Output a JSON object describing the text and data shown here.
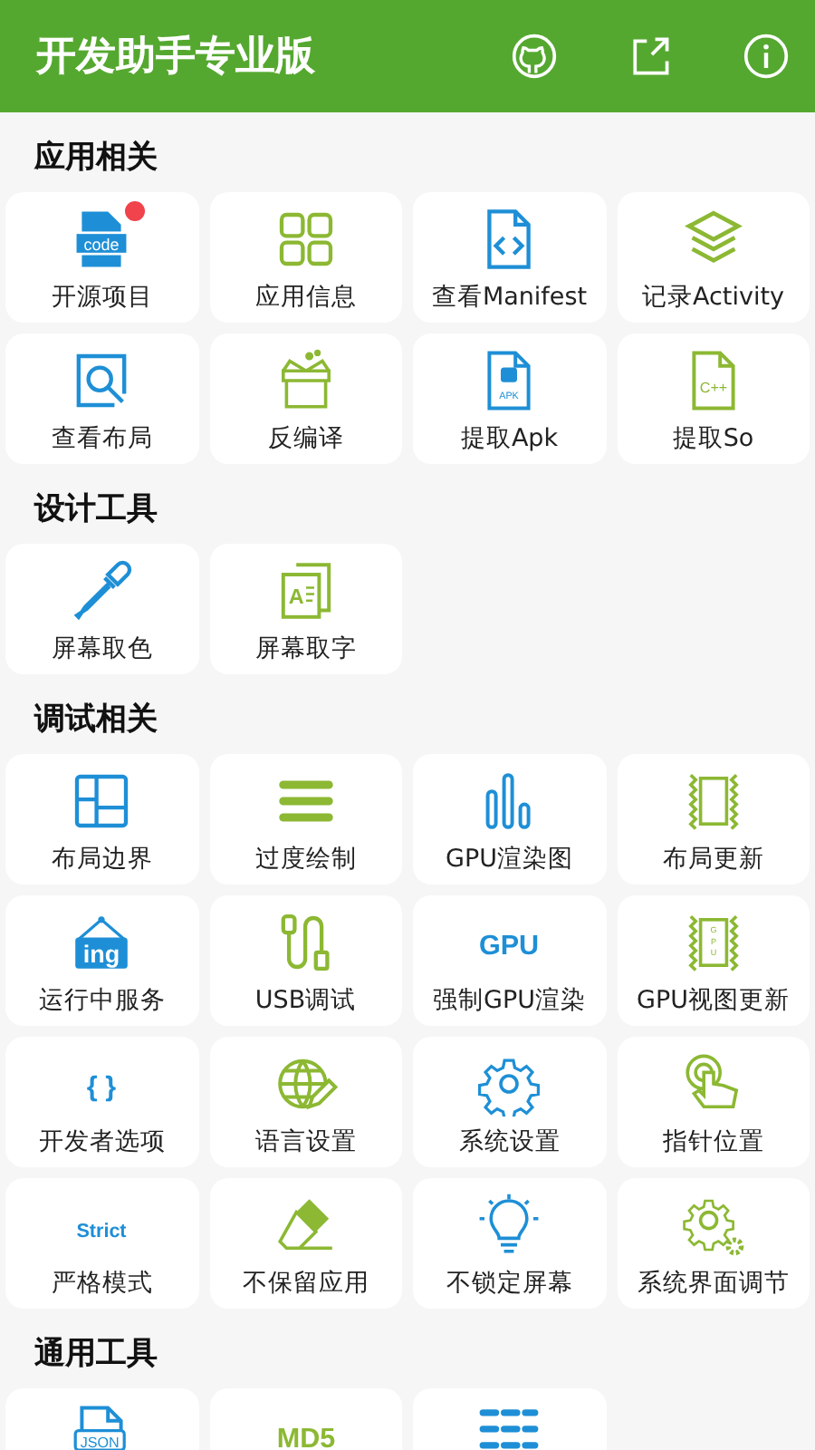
{
  "app_bar": {
    "title": "开发助手专业版",
    "actions": [
      {
        "kind": "github"
      },
      {
        "kind": "share"
      },
      {
        "kind": "info"
      }
    ]
  },
  "sections": [
    {
      "title": "应用相关",
      "items": [
        {
          "label": "开源项目",
          "kind": "code-file",
          "icon_text": "code",
          "color": "#1e8fd6",
          "badge": true
        },
        {
          "label": "应用信息",
          "kind": "grid",
          "color": "#8cb833",
          "badge": false
        },
        {
          "label": "查看Manifest",
          "kind": "manifest",
          "color": "#1e8fd6",
          "badge": false
        },
        {
          "label": "记录Activity",
          "kind": "layers",
          "color": "#8cb833",
          "badge": false
        },
        {
          "label": "查看布局",
          "kind": "search-frame",
          "color": "#1e8fd6",
          "badge": false
        },
        {
          "label": "反编译",
          "kind": "box",
          "color": "#8cb833",
          "badge": false
        },
        {
          "label": "提取Apk",
          "kind": "apk-file",
          "icon_text": "APK",
          "color": "#1e8fd6",
          "badge": false
        },
        {
          "label": "提取So",
          "kind": "cpp-file",
          "icon_text": "C++",
          "color": "#8cb833",
          "badge": false
        }
      ]
    },
    {
      "title": "设计工具",
      "items": [
        {
          "label": "屏幕取色",
          "kind": "dropper",
          "color": "#1e8fd6",
          "badge": false
        },
        {
          "label": "屏幕取字",
          "kind": "text-doc",
          "icon_text": "A",
          "color": "#8cb833",
          "badge": false
        }
      ]
    },
    {
      "title": "调试相关",
      "items": [
        {
          "label": "布局边界",
          "kind": "layout",
          "color": "#1e8fd6",
          "badge": false
        },
        {
          "label": "过度绘制",
          "kind": "bars",
          "color": "#8cb833",
          "badge": false
        },
        {
          "label": "GPU渲染图",
          "kind": "chart",
          "color": "#1e8fd6",
          "badge": false
        },
        {
          "label": "布局更新",
          "kind": "wave-frame",
          "color": "#8cb833",
          "badge": false
        },
        {
          "label": "运行中服务",
          "kind": "sign",
          "icon_text": "ing",
          "color": "#1e8fd6",
          "badge": false
        },
        {
          "label": "USB调试",
          "kind": "cable",
          "color": "#8cb833",
          "badge": false
        },
        {
          "label": "强制GPU渲染",
          "kind": "word",
          "icon_text": "GPU",
          "color": "#1e8fd6",
          "badge": false
        },
        {
          "label": "GPU视图更新",
          "kind": "chip",
          "icon_text": "GPU",
          "color": "#8cb833",
          "badge": false
        },
        {
          "label": "开发者选项",
          "kind": "word",
          "icon_text": "{ }",
          "color": "#1e8fd6",
          "badge": false
        },
        {
          "label": "语言设置",
          "kind": "globe",
          "color": "#8cb833",
          "badge": false
        },
        {
          "label": "系统设置",
          "kind": "gear",
          "color": "#1e8fd6",
          "badge": false
        },
        {
          "label": "指针位置",
          "kind": "pointer",
          "color": "#8cb833",
          "badge": false
        },
        {
          "label": "严格模式",
          "kind": "word",
          "icon_text": "Strict",
          "color": "#1e8fd6",
          "badge": false
        },
        {
          "label": "不保留应用",
          "kind": "eraser",
          "color": "#8cb833",
          "badge": false
        },
        {
          "label": "不锁定屏幕",
          "kind": "bulb",
          "color": "#1e8fd6",
          "badge": false
        },
        {
          "label": "系统界面调节",
          "kind": "gears",
          "color": "#8cb833",
          "badge": false
        }
      ]
    },
    {
      "title": "通用工具",
      "items": [
        {
          "kind": "json-file",
          "icon_text": "JSON",
          "color": "#1e8fd6",
          "badge": false
        },
        {
          "kind": "word",
          "icon_text": "MD5",
          "color": "#8cb833",
          "badge": false
        },
        {
          "kind": "table",
          "color": "#1e8fd6",
          "badge": false
        }
      ]
    }
  ]
}
